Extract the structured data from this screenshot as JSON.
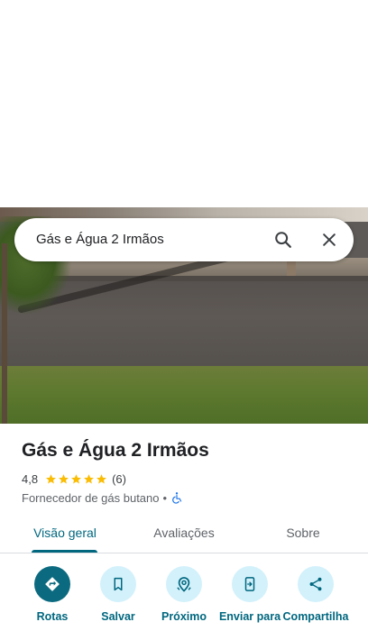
{
  "search": {
    "query": "Gás e Água 2 Irmãos"
  },
  "place": {
    "name": "Gás e Água 2 Irmãos",
    "rating": "4,8",
    "stars": 5,
    "review_count": "(6)",
    "category": "Fornecedor de gás butano",
    "separator": "•",
    "accessibility_icon": "wheelchair-icon"
  },
  "tabs": [
    {
      "label": "Visão geral",
      "active": true
    },
    {
      "label": "Avaliações",
      "active": false
    },
    {
      "label": "Sobre",
      "active": false
    }
  ],
  "actions": [
    {
      "label": "Rotas",
      "icon": "directions-icon"
    },
    {
      "label": "Salvar",
      "icon": "bookmark-icon"
    },
    {
      "label": "Próximo",
      "icon": "nearby-icon"
    },
    {
      "label": "Enviar para",
      "icon": "send-to-phone-icon"
    },
    {
      "label": "Compartilha",
      "icon": "share-icon"
    }
  ],
  "colors": {
    "accent": "#00677f",
    "primary_button": "#0b6a7f",
    "action_circle": "#d3f1fb",
    "star": "#fbbc04",
    "accessibility": "#1a73e8"
  }
}
